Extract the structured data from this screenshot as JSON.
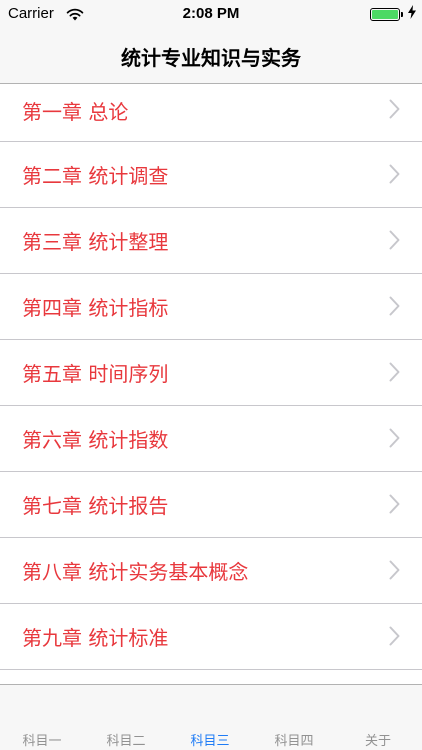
{
  "status_bar": {
    "carrier": "Carrier",
    "time": "2:08 PM",
    "wifi_icon": "wifi-icon",
    "battery_icon": "battery-icon",
    "charging_icon": "charging-icon"
  },
  "nav": {
    "title": "统计专业知识与实务"
  },
  "chapters": [
    {
      "label": "第一章 总论"
    },
    {
      "label": "第二章  统计调查"
    },
    {
      "label": "第三章  统计整理"
    },
    {
      "label": "第四章  统计指标"
    },
    {
      "label": "第五章  时间序列"
    },
    {
      "label": "第六章  统计指数"
    },
    {
      "label": "第七章 统计报告"
    },
    {
      "label": "第八章 统计实务基本概念"
    },
    {
      "label": "第九章  统计标准"
    }
  ],
  "tabs": [
    {
      "label": "科目一",
      "active": false
    },
    {
      "label": "科目二",
      "active": false
    },
    {
      "label": "科目三",
      "active": true
    },
    {
      "label": "科目四",
      "active": false
    },
    {
      "label": "关于",
      "active": false
    }
  ],
  "colors": {
    "chapter_text": "#e8383d",
    "tab_active": "#1f7cf6",
    "tab_inactive": "#929292",
    "battery": "#4cd964"
  }
}
